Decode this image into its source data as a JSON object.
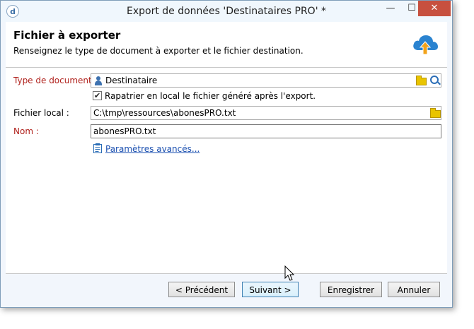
{
  "window": {
    "title": "Export de données 'Destinataires PRO' *",
    "app_icon_glyph": "d",
    "controls": {
      "minimize": "—",
      "maximize": "☐",
      "close": "✕"
    }
  },
  "header": {
    "title": "Fichier à exporter",
    "subtitle": "Renseignez le type de document à exporter et le fichier destination.",
    "icon": "cloud-upload-icon",
    "icon_color": "#2a83d0",
    "arrow_color": "#f2a31b"
  },
  "form": {
    "doc_type": {
      "label": "Type de document :",
      "value": "Destinataire"
    },
    "checkbox": {
      "checked": true,
      "mark": "✔",
      "label": "Rapatrier en local le fichier généré après l'export."
    },
    "local_file": {
      "label": "Fichier local :",
      "value": "C:\\tmp\\ressources\\abonesPRO.txt"
    },
    "name": {
      "label": "Nom :",
      "value": "abonesPRO.txt"
    },
    "advanced_link": "Paramètres avancés..."
  },
  "footer": {
    "previous": "< Précédent",
    "next": "Suivant >",
    "save": "Enregistrer",
    "cancel": "Annuler"
  },
  "colors": {
    "required_label": "#b0211c",
    "link": "#1a4fb0",
    "close_button": "#c7503f"
  }
}
